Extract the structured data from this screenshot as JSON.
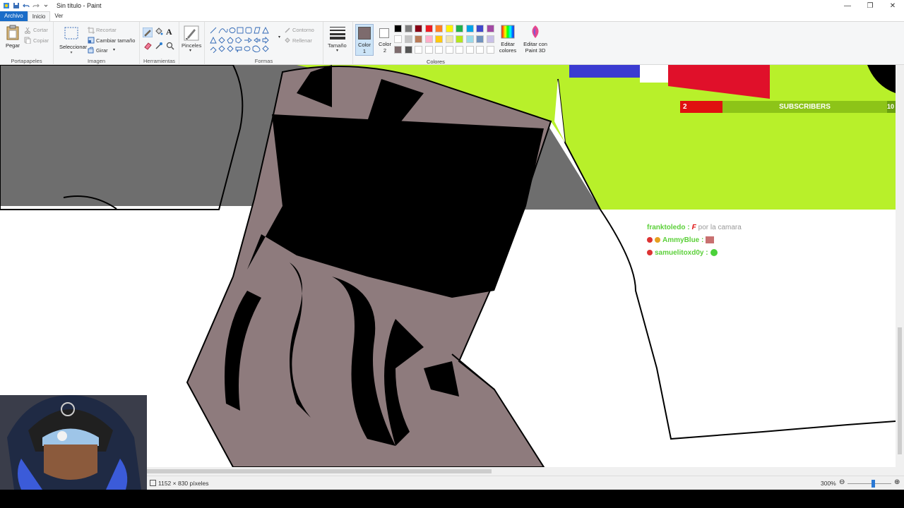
{
  "window": {
    "title": "Sin título - Paint",
    "controls": [
      "—",
      "❐",
      "✕"
    ]
  },
  "tabs": {
    "file": "Archivo",
    "home": "Inicio",
    "view": "Ver"
  },
  "ribbon": {
    "clipboard": {
      "paste": "Pegar",
      "cut": "Cortar",
      "copy": "Copiar",
      "group": "Portapapeles"
    },
    "image": {
      "select": "Seleccionar",
      "crop": "Recortar",
      "resize": "Cambiar tamaño",
      "rotate": "Girar",
      "group": "Imagen"
    },
    "tools": {
      "group": "Herramientas",
      "text_tool": "A"
    },
    "brushes": {
      "label": "Pinceles"
    },
    "shapes": {
      "outline": "Contorno",
      "fill": "Rellenar",
      "group": "Formas"
    },
    "size": {
      "label": "Tamaño"
    },
    "color1": {
      "label": "Color",
      "sub": "1",
      "value": "#7d6b6d"
    },
    "color2": {
      "label": "Color",
      "sub": "2",
      "value": "#ffffff"
    },
    "colors": {
      "group": "Colores",
      "edit": "Editar colores",
      "paint3d": "Editar con Paint 3D",
      "palette_row1": [
        "#000000",
        "#7f7f7f",
        "#880015",
        "#ed1c24",
        "#ff7f27",
        "#fff200",
        "#22b14c",
        "#00a2e8",
        "#3f48cc",
        "#a349a4"
      ],
      "palette_row2": [
        "#ffffff",
        "#c3c3c3",
        "#b97a57",
        "#ffaec9",
        "#ffc90e",
        "#efe4b0",
        "#b5e61d",
        "#99d9ea",
        "#7092be",
        "#c8bfe7"
      ],
      "palette_row3": [
        "#7d6b6d",
        "#555555",
        "#ffffff",
        "#ffffff",
        "#ffffff",
        "#ffffff",
        "#ffffff",
        "#ffffff",
        "#ffffff",
        "#ffffff"
      ]
    }
  },
  "status": {
    "size": "1152 × 830 píxeles",
    "zoom": "300%"
  },
  "overlay": {
    "subscribers": {
      "count": "2",
      "label": "SUBSCRIBERS",
      "goal": "10"
    },
    "chat": [
      {
        "user": "franktoledo :",
        "msg": "por la camara"
      },
      {
        "user": "AmmyBlue :",
        "msg": ""
      },
      {
        "user": "samuelitoxd0y :",
        "msg": ""
      }
    ]
  }
}
